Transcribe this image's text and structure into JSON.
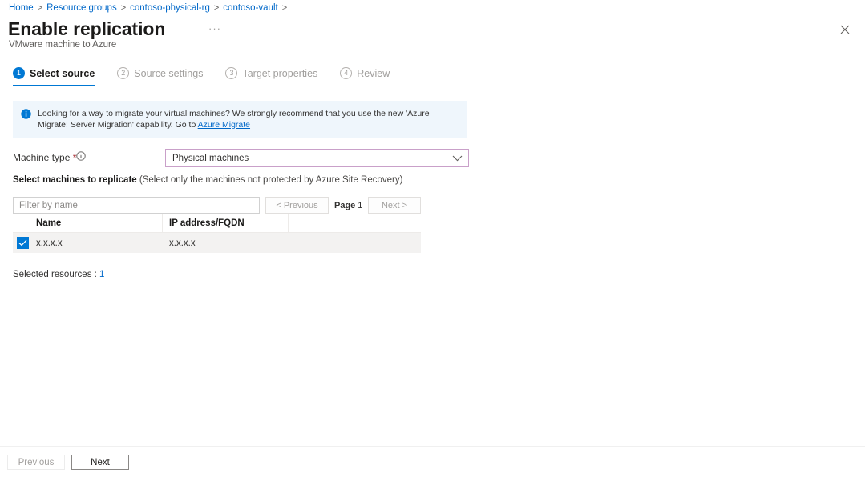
{
  "breadcrumb": {
    "items": [
      "Home",
      "Resource groups",
      "contoso-physical-rg",
      "contoso-vault"
    ],
    "separator": ">"
  },
  "header": {
    "title": "Enable replication",
    "subtitle": "VMware machine to Azure",
    "ellipsis": "···",
    "close_icon": "close-icon"
  },
  "tabs": [
    {
      "num": "1",
      "label": "Select source",
      "active": true
    },
    {
      "num": "2",
      "label": "Source settings",
      "active": false
    },
    {
      "num": "3",
      "label": "Target properties",
      "active": false
    },
    {
      "num": "4",
      "label": "Review",
      "active": false
    }
  ],
  "banner": {
    "icon": "info-icon",
    "text_before": "Looking for a way to migrate your virtual machines? We strongly recommend that you use the new 'Azure Migrate: Server Migration' capability. Go to ",
    "link": "Azure Migrate",
    "background": "#eff6fc"
  },
  "machine_type": {
    "label": "Machine type",
    "required_marker": "*",
    "info_icon": "info-circle-icon",
    "value": "Physical machines",
    "options": [
      "Physical machines"
    ],
    "chevron_icon": "chevron-down-icon",
    "border_color": "#c9a0c9"
  },
  "select_machines": {
    "label_bold": "Select machines to replicate",
    "label_note": "(Select only the machines not protected by Azure Site Recovery)"
  },
  "filter": {
    "placeholder": "Filter by name",
    "value": ""
  },
  "pagination": {
    "previous_label": "< Previous",
    "page_label": "Page",
    "page_number": "1",
    "next_label": "Next >",
    "previous_disabled": true,
    "next_disabled": true
  },
  "table": {
    "columns": [
      "",
      "Name",
      "IP address/FQDN",
      ""
    ],
    "rows": [
      {
        "checked": true,
        "name": "x.x.x.x",
        "ip": "x.x.x.x"
      }
    ]
  },
  "selected_resources": {
    "label": "Selected resources :",
    "count": "1",
    "count_color": "#0068c9"
  },
  "footer": {
    "previous_label": "Previous",
    "next_label": "Next",
    "previous_disabled": true
  },
  "colors": {
    "accent": "#0078d4",
    "link": "#0068c9",
    "row_bg": "#f3f2f1",
    "required": "#a4262c"
  }
}
